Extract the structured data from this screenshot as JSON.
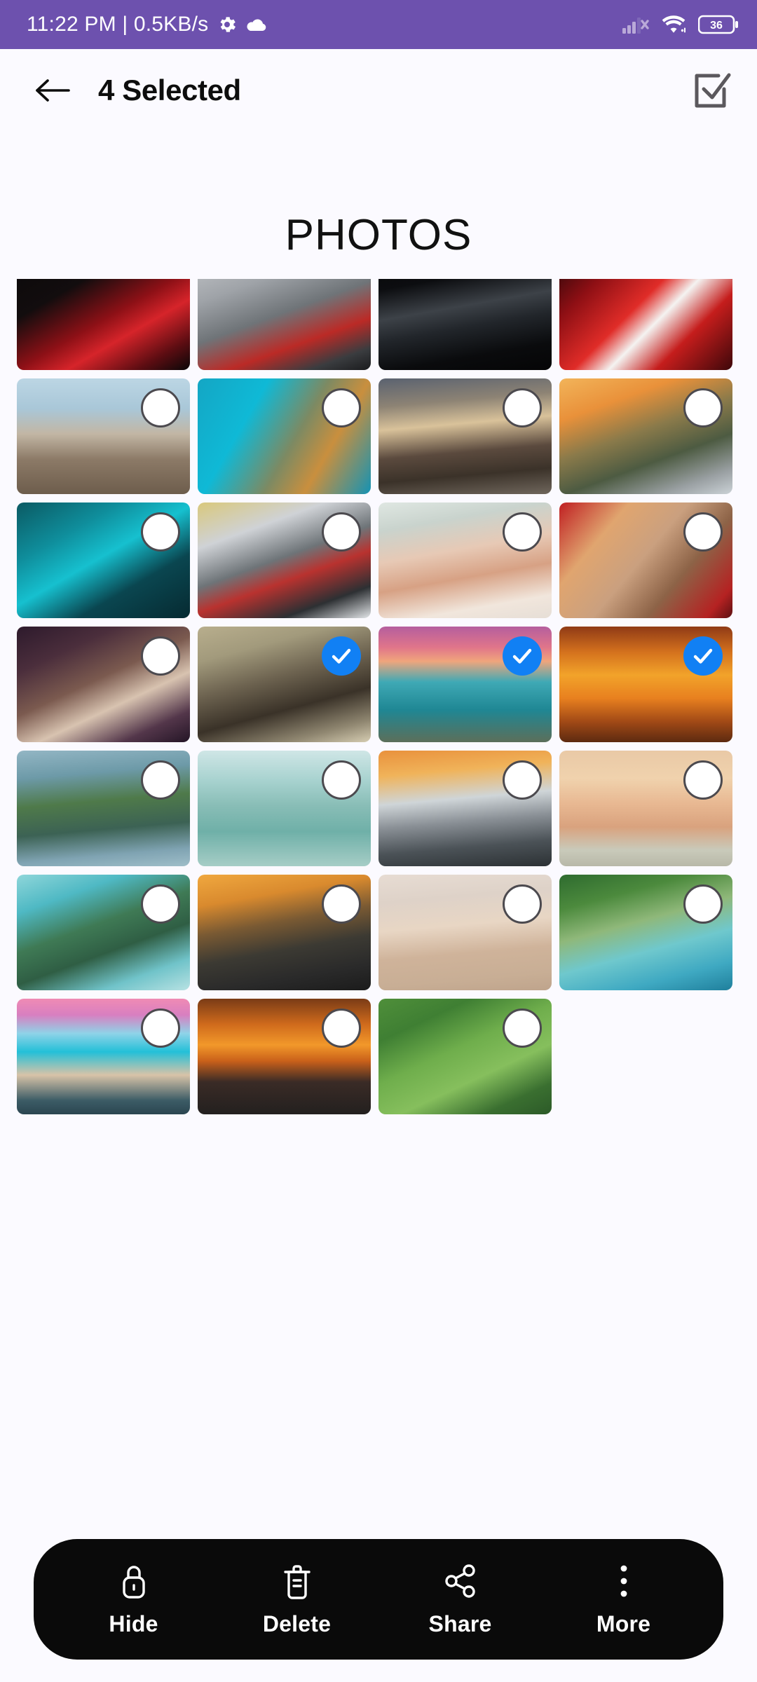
{
  "status_bar": {
    "clock_text": "11:22 PM | 0.5KB/s",
    "background_color": "#6d51ae",
    "icons": [
      "gear-icon",
      "cloud-icon",
      "signal-no-service-icon",
      "wifi-icon"
    ],
    "battery_level": "36"
  },
  "app_bar": {
    "back_icon": "arrow-left-icon",
    "title": "4 Selected",
    "select_all_icon": "checkbox-checked-icon"
  },
  "section": {
    "title": "PHOTOS"
  },
  "grid": {
    "columns": 4,
    "selected_count": 4,
    "selected_color": "#1180f4",
    "unselected_border_color": "#4c4a4f",
    "tiles": [
      {
        "name": "red-sports-car-rear",
        "selected": false,
        "badge_visible": false,
        "clipped": true,
        "gradient": "linear-gradient(150deg,#0a0809 0%,#120d0e 32%,#8d1016 55%,#d6242a 68%,#5d0d12 86%,#090708 100%)"
      },
      {
        "name": "silver-concept-car-front",
        "selected": false,
        "badge_visible": false,
        "clipped": true,
        "gradient": "linear-gradient(160deg,#c9cbce 0%,#9fa3a8 30%,#6f7478 52%,#bb2a26 72%,#3a3c3f 88%,#1a1b1d 100%)"
      },
      {
        "name": "black-sports-car-studio",
        "selected": false,
        "badge_visible": false,
        "clipped": true,
        "gradient": "linear-gradient(170deg,#050506 0%,#0c0d10 28%,#3d4248 48%,#22262b 62%,#0a0b0d 82%,#050506 100%)"
      },
      {
        "name": "red-supercar-closeup",
        "selected": false,
        "badge_visible": false,
        "clipped": true,
        "gradient": "linear-gradient(135deg,#1d0608 0%,#8e0f14 24%,#e02c28 46%,#f4f3f1 58%,#c51d1c 74%,#3d070a 100%)"
      },
      {
        "name": "woman-in-sea-wooden-poles",
        "selected": false,
        "badge_visible": true,
        "clipped": false,
        "gradient": "linear-gradient(180deg,#bcd6e4 0%,#a9c7d8 26%,#c2b6a4 48%,#8c7a67 70%,#6d5d4c 100%)"
      },
      {
        "name": "turquoise-aerial-coastline",
        "selected": false,
        "badge_visible": true,
        "clipped": false,
        "gradient": "linear-gradient(120deg,#14a6c4 0%,#0fb9d6 30%,#7c8a63 55%,#c98f3e 72%,#1593b4 100%)"
      },
      {
        "name": "rocky-coast-long-exposure",
        "selected": false,
        "badge_visible": true,
        "clipped": false,
        "gradient": "linear-gradient(175deg,#5a6270 0%,#8d8374 22%,#d9c29a 40%,#5b4a3e 62%,#3b3229 80%,#6f665c 100%)"
      },
      {
        "name": "cliff-sunset-seascape",
        "selected": false,
        "badge_visible": true,
        "clipped": false,
        "gradient": "linear-gradient(160deg,#f2b45a 0%,#e9913a 24%,#8a7a4a 46%,#4d5b42 66%,#9aa0a3 86%,#cbd2d6 100%)"
      },
      {
        "name": "whale-shark-underwater",
        "selected": false,
        "badge_visible": true,
        "clipped": false,
        "gradient": "linear-gradient(150deg,#0b5a63 0%,#0f8e9c 28%,#16c0cf 48%,#0a4650 70%,#062a31 100%)"
      },
      {
        "name": "motorcycle-racer-track",
        "selected": false,
        "badge_visible": true,
        "clipped": false,
        "gradient": "linear-gradient(160deg,#d9c87c 0%,#cfd2d6 26%,#6e7478 48%,#b9322f 62%,#2d3033 82%,#e2e5e8 100%)"
      },
      {
        "name": "woman-flower-crown",
        "selected": false,
        "badge_visible": true,
        "clipped": false,
        "gradient": "linear-gradient(170deg,#dfe7e2 0%,#c9d3cd 20%,#e7c9b5 42%,#d7a184 62%,#f1e6dc 84%,#e6ded6 100%)"
      },
      {
        "name": "portrait-woman-red-backdrop",
        "selected": false,
        "badge_visible": true,
        "clipped": false,
        "gradient": "linear-gradient(130deg,#c01f22 0%,#e0a56f 26%,#caa07f 48%,#8d6347 68%,#b52222 90%,#5d1012 100%)"
      },
      {
        "name": "woman-dark-hair-portrait",
        "selected": false,
        "badge_visible": true,
        "clipped": false,
        "gradient": "linear-gradient(155deg,#2d1a2c 0%,#4b2e3c 24%,#7b5a4f 46%,#d8c3b0 64%,#53364a 84%,#241526 100%)"
      },
      {
        "name": "surreal-woman-violin-tree",
        "selected": true,
        "badge_visible": true,
        "clipped": false,
        "gradient": "linear-gradient(165deg,#b8ae8d 0%,#a29a7c 22%,#6d6350 44%,#3a3228 66%,#8f8670 86%,#d6cdb2 100%)"
      },
      {
        "name": "lighthouse-pink-sunset-lake",
        "selected": true,
        "badge_visible": true,
        "clipped": false,
        "gradient": "linear-gradient(180deg,#b55e9e 0%,#e0758a 18%,#f0a57c 30%,#3fa9b5 48%,#1f8794 72%,#5c6f5a 100%)"
      },
      {
        "name": "fisherman-boat-orange-sunset",
        "selected": true,
        "badge_visible": true,
        "clipped": false,
        "gradient": "linear-gradient(180deg,#8f3a16 0%,#d4711d 22%,#f2a32a 42%,#e8801f 62%,#a24a16 82%,#5d2a10 100%)"
      },
      {
        "name": "green-sea-arch-island",
        "selected": false,
        "badge_visible": true,
        "clipped": false,
        "gradient": "linear-gradient(175deg,#93b6c4 0%,#6d9aa8 22%,#4f7a4a 44%,#3c6254 66%,#7fa3b2 86%,#9fbec9 100%)"
      },
      {
        "name": "boats-calm-turquoise-water",
        "selected": false,
        "badge_visible": true,
        "clipped": false,
        "gradient": "linear-gradient(180deg,#cfe6e6 0%,#a7d2cf 26%,#88bdb6 48%,#6fb0a8 70%,#a6cdc6 100%)"
      },
      {
        "name": "lighthouse-pier-sunset",
        "selected": false,
        "badge_visible": true,
        "clipped": false,
        "gradient": "linear-gradient(175deg,#e9913c 0%,#f0b35a 20%,#cfd5d8 42%,#8a9096 60%,#4b5257 80%,#2c3134 100%)"
      },
      {
        "name": "hammock-sunset-water",
        "selected": false,
        "badge_visible": true,
        "clipped": false,
        "gradient": "linear-gradient(180deg,#e9c9a6 0%,#f0d2ad 24%,#e8b892 46%,#d9a27e 66%,#c9caba 86%,#b8b8a8 100%)"
      },
      {
        "name": "coastal-road-cliff-boat",
        "selected": false,
        "badge_visible": true,
        "clipped": false,
        "gradient": "linear-gradient(160deg,#8fd6da 0%,#4fb9c4 22%,#3f7a55 44%,#2f5e44 62%,#70c3c9 82%,#b8e2e3 100%)"
      },
      {
        "name": "palm-tree-over-water-sunset",
        "selected": false,
        "badge_visible": true,
        "clipped": false,
        "gradient": "linear-gradient(170deg,#f0a83f 0%,#d98a2e 22%,#7a5a33 42%,#3c3a33 62%,#2a2a2a 82%,#1b1b1b 100%)"
      },
      {
        "name": "woman-lantern-on-beach",
        "selected": false,
        "badge_visible": true,
        "clipped": false,
        "gradient": "linear-gradient(175deg,#e7dcd3 0%,#ded2c8 22%,#e8d6c4 44%,#cfb39a 66%,#c8ae95 86%,#bfa48c 100%)"
      },
      {
        "name": "tropical-island-seaplane",
        "selected": false,
        "badge_visible": true,
        "clipped": false,
        "gradient": "linear-gradient(165deg,#2e6b2f 0%,#4c8a3d 22%,#8fb87a 42%,#6fc8cd 62%,#3fa9c2 82%,#1f7f9c 100%)"
      },
      {
        "name": "aerial-beach-city-pier",
        "selected": false,
        "badge_visible": true,
        "clipped": false,
        "gradient": "linear-gradient(180deg,#f08bb4 0%,#d87fc0 14%,#8fd3e8 30%,#23c0d8 46%,#d8c3a8 66%,#3c5c66 88%,#2b4550 100%)"
      },
      {
        "name": "sailboat-orange-sunset-sea",
        "selected": false,
        "badge_visible": true,
        "clipped": false,
        "gradient": "linear-gradient(180deg,#7a3b16 0%,#cf6a1c 22%,#f2982a 40%,#c9601a 54%,#3a2b26 72%,#23201f 100%)"
      },
      {
        "name": "aerial-winding-road-hills",
        "selected": false,
        "badge_visible": true,
        "clipped": false,
        "gradient": "linear-gradient(155deg,#4f8f3a 0%,#3f7f33 22%,#6fae4c 44%,#86bf5d 64%,#3a6f30 84%,#2c5a28 100%)"
      }
    ]
  },
  "action_bar": {
    "background_color": "#0a0a0a",
    "items": [
      {
        "label": "Hide",
        "icon": "lock-icon"
      },
      {
        "label": "Delete",
        "icon": "trash-icon"
      },
      {
        "label": "Share",
        "icon": "share-icon"
      },
      {
        "label": "More",
        "icon": "more-vertical-icon"
      }
    ]
  }
}
